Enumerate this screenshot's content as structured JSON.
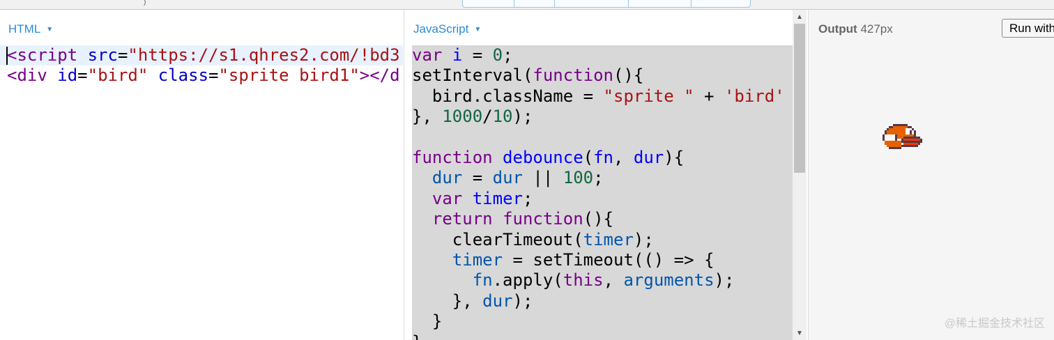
{
  "toolbar": {
    "topbar_tick": ")"
  },
  "html_pane": {
    "label": "HTML",
    "caret": "▼",
    "lines": [
      [
        {
          "t": "<",
          "c": "tk-html-tag"
        },
        {
          "t": "script",
          "c": "tk-html-tag"
        },
        {
          "t": " ",
          "c": "tk-plain"
        },
        {
          "t": "src",
          "c": "tk-html-attr"
        },
        {
          "t": "=",
          "c": "tk-plain"
        },
        {
          "t": "\"https://s1.qhres2.com/!bd3",
          "c": "tk-str"
        }
      ],
      [
        {
          "t": "<",
          "c": "tk-html-tag"
        },
        {
          "t": "div",
          "c": "tk-html-tag"
        },
        {
          "t": " ",
          "c": "tk-plain"
        },
        {
          "t": "id",
          "c": "tk-html-attr"
        },
        {
          "t": "=",
          "c": "tk-plain"
        },
        {
          "t": "\"bird\"",
          "c": "tk-str"
        },
        {
          "t": " ",
          "c": "tk-plain"
        },
        {
          "t": "class",
          "c": "tk-html-attr"
        },
        {
          "t": "=",
          "c": "tk-plain"
        },
        {
          "t": "\"sprite bird1\"",
          "c": "tk-str"
        },
        {
          "t": "></d",
          "c": "tk-html-tag"
        }
      ]
    ]
  },
  "js_pane": {
    "label": "JavaScript",
    "caret": "▼",
    "lines": [
      [
        {
          "t": "var",
          "c": "tk-kw"
        },
        {
          "t": " ",
          "c": "tk-plain"
        },
        {
          "t": "i",
          "c": "tk-def"
        },
        {
          "t": " = ",
          "c": "tk-plain"
        },
        {
          "t": "0",
          "c": "tk-num"
        },
        {
          "t": ";",
          "c": "tk-plain"
        }
      ],
      [
        {
          "t": "setInterval(",
          "c": "tk-plain"
        },
        {
          "t": "function",
          "c": "tk-kw"
        },
        {
          "t": "(){",
          "c": "tk-plain"
        }
      ],
      [
        {
          "t": "  bird.className = ",
          "c": "tk-plain"
        },
        {
          "t": "\"sprite \"",
          "c": "tk-str"
        },
        {
          "t": " + ",
          "c": "tk-plain"
        },
        {
          "t": "'bird'",
          "c": "tk-str"
        }
      ],
      [
        {
          "t": "}, ",
          "c": "tk-plain"
        },
        {
          "t": "1000",
          "c": "tk-num"
        },
        {
          "t": "/",
          "c": "tk-plain"
        },
        {
          "t": "10",
          "c": "tk-num"
        },
        {
          "t": ");",
          "c": "tk-plain"
        }
      ],
      [
        {
          "t": "",
          "c": "tk-plain"
        }
      ],
      [
        {
          "t": "function",
          "c": "tk-kw"
        },
        {
          "t": " ",
          "c": "tk-plain"
        },
        {
          "t": "debounce",
          "c": "tk-def"
        },
        {
          "t": "(",
          "c": "tk-plain"
        },
        {
          "t": "fn",
          "c": "tk-def"
        },
        {
          "t": ", ",
          "c": "tk-plain"
        },
        {
          "t": "dur",
          "c": "tk-def"
        },
        {
          "t": "){",
          "c": "tk-plain"
        }
      ],
      [
        {
          "t": "  ",
          "c": "tk-plain"
        },
        {
          "t": "dur",
          "c": "tk-var"
        },
        {
          "t": " = ",
          "c": "tk-plain"
        },
        {
          "t": "dur",
          "c": "tk-var"
        },
        {
          "t": " || ",
          "c": "tk-plain"
        },
        {
          "t": "100",
          "c": "tk-num"
        },
        {
          "t": ";",
          "c": "tk-plain"
        }
      ],
      [
        {
          "t": "  ",
          "c": "tk-plain"
        },
        {
          "t": "var",
          "c": "tk-kw"
        },
        {
          "t": " ",
          "c": "tk-plain"
        },
        {
          "t": "timer",
          "c": "tk-def"
        },
        {
          "t": ";",
          "c": "tk-plain"
        }
      ],
      [
        {
          "t": "  ",
          "c": "tk-plain"
        },
        {
          "t": "return",
          "c": "tk-kw"
        },
        {
          "t": " ",
          "c": "tk-plain"
        },
        {
          "t": "function",
          "c": "tk-kw"
        },
        {
          "t": "(){",
          "c": "tk-plain"
        }
      ],
      [
        {
          "t": "    clearTimeout(",
          "c": "tk-plain"
        },
        {
          "t": "timer",
          "c": "tk-var"
        },
        {
          "t": ");",
          "c": "tk-plain"
        }
      ],
      [
        {
          "t": "    ",
          "c": "tk-plain"
        },
        {
          "t": "timer",
          "c": "tk-var"
        },
        {
          "t": " = setTimeout(() => {",
          "c": "tk-plain"
        }
      ],
      [
        {
          "t": "      ",
          "c": "tk-plain"
        },
        {
          "t": "fn",
          "c": "tk-var"
        },
        {
          "t": ".apply(",
          "c": "tk-plain"
        },
        {
          "t": "this",
          "c": "tk-kw"
        },
        {
          "t": ", ",
          "c": "tk-plain"
        },
        {
          "t": "arguments",
          "c": "tk-var"
        },
        {
          "t": ");",
          "c": "tk-plain"
        }
      ],
      [
        {
          "t": "    }, ",
          "c": "tk-plain"
        },
        {
          "t": "dur",
          "c": "tk-var"
        },
        {
          "t": ");",
          "c": "tk-plain"
        }
      ],
      [
        {
          "t": "  }",
          "c": "tk-plain"
        }
      ],
      [
        {
          "t": "}",
          "c": "tk-plain"
        }
      ]
    ],
    "scroll_up": "▲",
    "scroll_down": "▼"
  },
  "output_pane": {
    "label": "Output",
    "width_text": "427px",
    "run_button": "Run with JS",
    "watermark": "@稀土掘金技术社区"
  },
  "colors": {
    "accent_blue": "#2a8ad8",
    "editor_bg": "#d8d8d8",
    "output_bg": "#f5f5f5"
  }
}
